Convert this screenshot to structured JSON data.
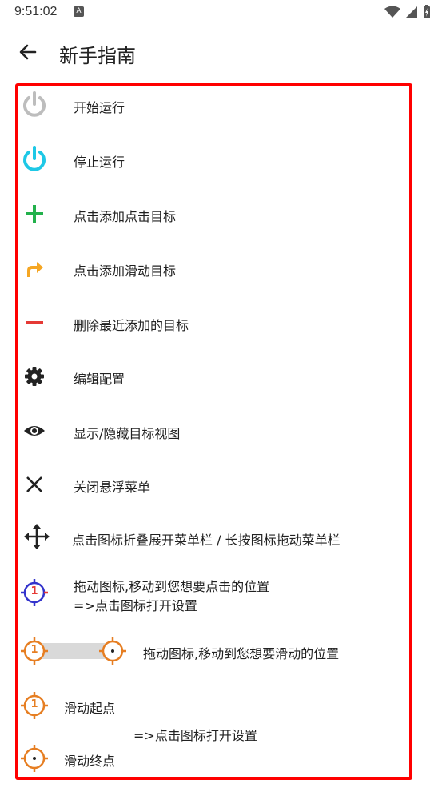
{
  "status_bar": {
    "time": "9:51:02",
    "notification_icon": "A"
  },
  "app_bar": {
    "title": "新手指南",
    "back_icon": "arrow-left-icon"
  },
  "guide_items": [
    {
      "icon": "power-gray-icon",
      "label": "开始运行"
    },
    {
      "icon": "power-cyan-icon",
      "label": "停止运行"
    },
    {
      "icon": "plus-green-icon",
      "label": "点击添加点击目标"
    },
    {
      "icon": "swipe-arrow-icon",
      "label": "点击添加滑动目标"
    },
    {
      "icon": "minus-red-icon",
      "label": "删除最近添加的目标"
    },
    {
      "icon": "gear-icon",
      "label": "编辑配置"
    },
    {
      "icon": "eye-icon",
      "label": "显示/隐藏目标视图"
    },
    {
      "icon": "close-icon",
      "label": "关闭悬浮菜单"
    },
    {
      "icon": "move-icon",
      "label": "点击图标折叠展开菜单栏 / 长按图标拖动菜单栏"
    },
    {
      "icon": "click-target-icon",
      "label": "拖动图标,移动到您想要点击的位置",
      "label2": "=>点击图标打开设置"
    },
    {
      "icon": "swipe-target-icon",
      "label": "拖动图标,移动到您想要滑动的位置"
    },
    {
      "icon": "swipe-start-icon",
      "label": "滑动起点"
    },
    {
      "icon": "swipe-end-icon",
      "label": "滑动终点"
    }
  ],
  "swipe_settings_hint": "=>点击图标打开设置",
  "target_number": "1",
  "colors": {
    "border": "#ff0000",
    "green": "#22b14c",
    "cyan": "#1ec8e6",
    "orange": "#f5a623",
    "red": "#e53935",
    "blue": "#3333cc",
    "target_orange": "#e67e22"
  }
}
